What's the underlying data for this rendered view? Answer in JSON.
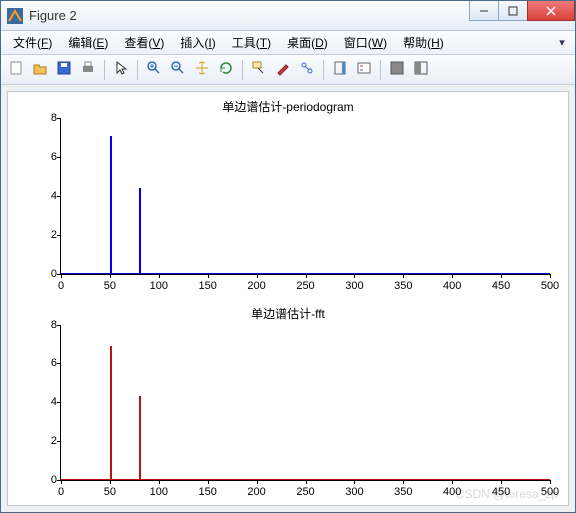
{
  "window": {
    "title": "Figure 2"
  },
  "menu": {
    "items": [
      {
        "label": "文件",
        "key": "F"
      },
      {
        "label": "编辑",
        "key": "E"
      },
      {
        "label": "查看",
        "key": "V"
      },
      {
        "label": "插入",
        "key": "I"
      },
      {
        "label": "工具",
        "key": "T"
      },
      {
        "label": "桌面",
        "key": "D"
      },
      {
        "label": "窗口",
        "key": "W"
      },
      {
        "label": "帮助",
        "key": "H"
      }
    ]
  },
  "toolbar": {
    "icons": [
      "new",
      "open",
      "save",
      "print",
      "sep",
      "pointer",
      "sep",
      "zoom-in",
      "zoom-out",
      "pan",
      "rotate",
      "sep",
      "datacursor",
      "brush",
      "link",
      "sep",
      "colorbar",
      "legend",
      "sep",
      "layout1",
      "layout2"
    ]
  },
  "chart_data": [
    {
      "type": "line",
      "title": "单边谱估计-periodogram",
      "xlim": [
        0,
        500
      ],
      "ylim": [
        0,
        8
      ],
      "xticks": [
        0,
        50,
        100,
        150,
        200,
        250,
        300,
        350,
        400,
        450,
        500
      ],
      "yticks": [
        0,
        2,
        4,
        6,
        8
      ],
      "color": "#0000ee",
      "peaks": [
        {
          "x": 50,
          "y": 7.1
        },
        {
          "x": 80,
          "y": 4.4
        }
      ]
    },
    {
      "type": "line",
      "title": "单边谱估计-fft",
      "xlim": [
        0,
        500
      ],
      "ylim": [
        0,
        8
      ],
      "xticks": [
        0,
        50,
        100,
        150,
        200,
        250,
        300,
        350,
        400,
        450,
        500
      ],
      "yticks": [
        0,
        2,
        4,
        6,
        8
      ],
      "color": "#c01010",
      "peaks": [
        {
          "x": 50,
          "y": 6.9
        },
        {
          "x": 80,
          "y": 4.3
        }
      ]
    }
  ],
  "watermark": "CSDN @teresa_zp"
}
